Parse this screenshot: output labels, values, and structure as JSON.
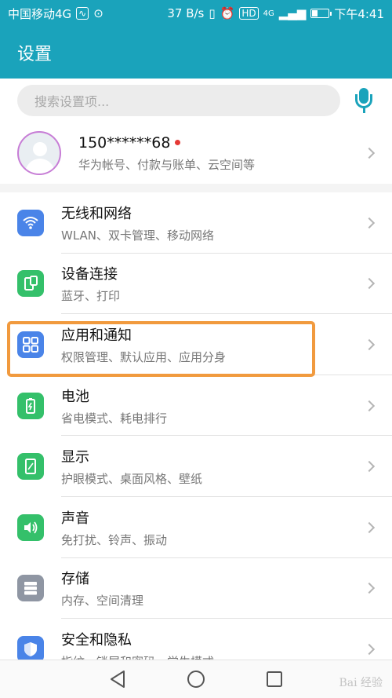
{
  "status_bar": {
    "carrier": "中国移动4G",
    "speed": "37 B/s",
    "hd": "HD",
    "signal": "4G",
    "time": "下午4:41"
  },
  "header": {
    "title": "设置"
  },
  "search": {
    "placeholder": "搜索设置项..."
  },
  "account": {
    "name": "150******68",
    "subtitle": "华为帐号、付款与账单、云空间等"
  },
  "settings": [
    {
      "title": "无线和网络",
      "subtitle": "WLAN、双卡管理、移动网络",
      "icon": "wifi-icon",
      "color": "#4a84e8"
    },
    {
      "title": "设备连接",
      "subtitle": "蓝牙、打印",
      "icon": "device-connection-icon",
      "color": "#34c06a"
    },
    {
      "title": "应用和通知",
      "subtitle": "权限管理、默认应用、应用分身",
      "icon": "apps-grid-icon",
      "color": "#4a84e8"
    },
    {
      "title": "电池",
      "subtitle": "省电模式、耗电排行",
      "icon": "battery-icon",
      "color": "#34c06a"
    },
    {
      "title": "显示",
      "subtitle": "护眼模式、桌面风格、壁纸",
      "icon": "display-icon",
      "color": "#34c06a"
    },
    {
      "title": "声音",
      "subtitle": "免打扰、铃声、振动",
      "icon": "sound-icon",
      "color": "#34c06a"
    },
    {
      "title": "存储",
      "subtitle": "内存、空间清理",
      "icon": "storage-icon",
      "color": "#8f96a3"
    },
    {
      "title": "安全和隐私",
      "subtitle": "指纹、锁屏和密码、学生模式",
      "icon": "shield-icon",
      "color": "#4a84e8"
    }
  ],
  "watermark": "Bai 经验",
  "colors": {
    "accent": "#1aa3bb",
    "highlight": "#f19a3e"
  }
}
